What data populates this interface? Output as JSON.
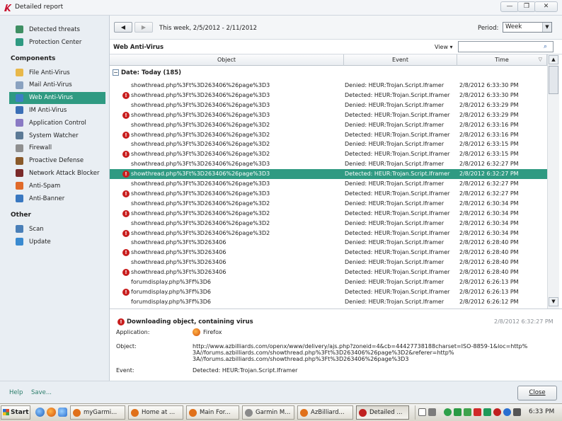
{
  "window": {
    "title": "Detailed report",
    "controls": {
      "minimize": "—",
      "maximize": "❐",
      "close": "✕"
    }
  },
  "sidebar": {
    "top_items": [
      {
        "label": "Detected threats",
        "icon": "shield-icon",
        "color": "#3f8f63"
      },
      {
        "label": "Protection Center",
        "icon": "shield-check-icon",
        "color": "#2f9a82"
      }
    ],
    "components_header": "Components",
    "components": [
      {
        "label": "File Anti-Virus",
        "icon": "folder-icon",
        "color": "#e8b84a"
      },
      {
        "label": "Mail Anti-Virus",
        "icon": "mail-icon",
        "color": "#8aa2c0"
      },
      {
        "label": "Web Anti-Virus",
        "icon": "globe-icon",
        "color": "#3d7fc4",
        "active": true
      },
      {
        "label": "IM Anti-Virus",
        "icon": "chat-icon",
        "color": "#3b6fb6"
      },
      {
        "label": "Application Control",
        "icon": "app-control-icon",
        "color": "#8a7ac4"
      },
      {
        "label": "System Watcher",
        "icon": "eye-icon",
        "color": "#5c7a96"
      },
      {
        "label": "Firewall",
        "icon": "firewall-icon",
        "color": "#8f8f8f"
      },
      {
        "label": "Proactive Defense",
        "icon": "proactive-shield-icon",
        "color": "#8a5a2a"
      },
      {
        "label": "Network Attack Blocker",
        "icon": "network-icon",
        "color": "#7a2a2a"
      },
      {
        "label": "Anti-Spam",
        "icon": "spam-icon",
        "color": "#e06a2a"
      },
      {
        "label": "Anti-Banner",
        "icon": "banner-icon",
        "color": "#3a78c0"
      }
    ],
    "other_header": "Other",
    "other": [
      {
        "label": "Scan",
        "icon": "scan-icon",
        "color": "#4a7fb8"
      },
      {
        "label": "Update",
        "icon": "update-icon",
        "color": "#3a8ad0"
      }
    ]
  },
  "toolbar": {
    "back": "◀",
    "forward": "▶",
    "period_text": "This week, 2/5/2012 - 2/11/2012",
    "period_label": "Period:",
    "period_value": "Week",
    "dropdown_glyph": "▼"
  },
  "panel": {
    "title": "Web Anti-Virus",
    "view_label": "View ▾",
    "search_icon": "⌕"
  },
  "table": {
    "columns": {
      "object": "Object",
      "event": "Event",
      "time": "Time",
      "sort_glyph": "▽"
    },
    "group_toggle": "−",
    "group_label": "Date: Today (185)",
    "rows": [
      {
        "object": "showthread.php%3Ft%3D263406%26page%3D3",
        "event": "Denied: HEUR:Trojan.Script.Iframer",
        "time": "2/8/2012 6:33:30 PM",
        "warn": false
      },
      {
        "object": "showthread.php%3Ft%3D263406%26page%3D3",
        "event": "Detected: HEUR:Trojan.Script.Iframer",
        "time": "2/8/2012 6:33:30 PM",
        "warn": true
      },
      {
        "object": "showthread.php%3Ft%3D263406%26page%3D3",
        "event": "Denied: HEUR:Trojan.Script.Iframer",
        "time": "2/8/2012 6:33:29 PM",
        "warn": false
      },
      {
        "object": "showthread.php%3Ft%3D263406%26page%3D3",
        "event": "Detected: HEUR:Trojan.Script.Iframer",
        "time": "2/8/2012 6:33:29 PM",
        "warn": true
      },
      {
        "object": "showthread.php%3Ft%3D263406%26page%3D2",
        "event": "Denied: HEUR:Trojan.Script.Iframer",
        "time": "2/8/2012 6:33:16 PM",
        "warn": false
      },
      {
        "object": "showthread.php%3Ft%3D263406%26page%3D2",
        "event": "Detected: HEUR:Trojan.Script.Iframer",
        "time": "2/8/2012 6:33:16 PM",
        "warn": true
      },
      {
        "object": "showthread.php%3Ft%3D263406%26page%3D2",
        "event": "Denied: HEUR:Trojan.Script.Iframer",
        "time": "2/8/2012 6:33:15 PM",
        "warn": false
      },
      {
        "object": "showthread.php%3Ft%3D263406%26page%3D2",
        "event": "Detected: HEUR:Trojan.Script.Iframer",
        "time": "2/8/2012 6:33:15 PM",
        "warn": true
      },
      {
        "object": "showthread.php%3Ft%3D263406%26page%3D3",
        "event": "Denied: HEUR:Trojan.Script.Iframer",
        "time": "2/8/2012 6:32:27 PM",
        "warn": false
      },
      {
        "object": "showthread.php%3Ft%3D263406%26page%3D3",
        "event": "Detected: HEUR:Trojan.Script.Iframer",
        "time": "2/8/2012 6:32:27 PM",
        "warn": true,
        "selected": true
      },
      {
        "object": "showthread.php%3Ft%3D263406%26page%3D3",
        "event": "Denied: HEUR:Trojan.Script.Iframer",
        "time": "2/8/2012 6:32:27 PM",
        "warn": false
      },
      {
        "object": "showthread.php%3Ft%3D263406%26page%3D3",
        "event": "Detected: HEUR:Trojan.Script.Iframer",
        "time": "2/8/2012 6:32:27 PM",
        "warn": true
      },
      {
        "object": "showthread.php%3Ft%3D263406%26page%3D2",
        "event": "Denied: HEUR:Trojan.Script.Iframer",
        "time": "2/8/2012 6:30:34 PM",
        "warn": false
      },
      {
        "object": "showthread.php%3Ft%3D263406%26page%3D2",
        "event": "Detected: HEUR:Trojan.Script.Iframer",
        "time": "2/8/2012 6:30:34 PM",
        "warn": true
      },
      {
        "object": "showthread.php%3Ft%3D263406%26page%3D2",
        "event": "Denied: HEUR:Trojan.Script.Iframer",
        "time": "2/8/2012 6:30:34 PM",
        "warn": false
      },
      {
        "object": "showthread.php%3Ft%3D263406%26page%3D2",
        "event": "Detected: HEUR:Trojan.Script.Iframer",
        "time": "2/8/2012 6:30:34 PM",
        "warn": true
      },
      {
        "object": "showthread.php%3Ft%3D263406",
        "event": "Denied: HEUR:Trojan.Script.Iframer",
        "time": "2/8/2012 6:28:40 PM",
        "warn": false
      },
      {
        "object": "showthread.php%3Ft%3D263406",
        "event": "Detected: HEUR:Trojan.Script.Iframer",
        "time": "2/8/2012 6:28:40 PM",
        "warn": true
      },
      {
        "object": "showthread.php%3Ft%3D263406",
        "event": "Denied: HEUR:Trojan.Script.Iframer",
        "time": "2/8/2012 6:28:40 PM",
        "warn": false
      },
      {
        "object": "showthread.php%3Ft%3D263406",
        "event": "Detected: HEUR:Trojan.Script.Iframer",
        "time": "2/8/2012 6:28:40 PM",
        "warn": true
      },
      {
        "object": "forumdisplay.php%3Ff%3D6",
        "event": "Denied: HEUR:Trojan.Script.Iframer",
        "time": "2/8/2012 6:26:13 PM",
        "warn": false
      },
      {
        "object": "forumdisplay.php%3Ff%3D6",
        "event": "Detected: HEUR:Trojan.Script.Iframer",
        "time": "2/8/2012 6:26:13 PM",
        "warn": true
      },
      {
        "object": "forumdisplay.php%3Ff%3D6",
        "event": "Denied: HEUR:Trojan.Script.Iframer",
        "time": "2/8/2012 6:26:12 PM",
        "warn": false
      }
    ],
    "scroll_up": "▲",
    "scroll_down": "▼"
  },
  "detail": {
    "warn_glyph": "!",
    "title": "Downloading object, containing virus",
    "time": "2/8/2012 6:32:27 PM",
    "application_label": "Application:",
    "application_value": "Firefox",
    "object_label": "Object:",
    "object_line1": "http://www.azbilliards.com/openx/www/delivery/ajs.php?zoneid=4&cb=44427738188charset=ISO-8859-1&loc=http%",
    "object_line2": "3A//forums.azbilliards.com/showthread.php%3Ft%3D263406%26page%3D2&referer=http%",
    "object_line3": "3A//forums.azbilliards.com/showthread.php%3Ft%3D263406%26page%3D3",
    "event_label": "Event:",
    "event_value": "Detected: HEUR:Trojan.Script.Iframer"
  },
  "footer": {
    "help": "Help",
    "save": "Save...",
    "close": "Close"
  },
  "taskbar": {
    "start": "Start",
    "tasks": [
      {
        "label": "myGarmi...",
        "icon": "firefox-icon",
        "color": "#e0701a"
      },
      {
        "label": "Home at ...",
        "icon": "firefox-icon",
        "color": "#e0701a"
      },
      {
        "label": "Main For...",
        "icon": "firefox-icon",
        "color": "#e0701a"
      },
      {
        "label": "Garmin M...",
        "icon": "document-icon",
        "color": "#8a8a8a"
      },
      {
        "label": "AzBilliard...",
        "icon": "firefox-icon",
        "color": "#e0701a"
      },
      {
        "label": "Detailed ...",
        "icon": "kaspersky-icon",
        "color": "#c02020",
        "active": true
      }
    ],
    "clock": "6:33 PM"
  }
}
